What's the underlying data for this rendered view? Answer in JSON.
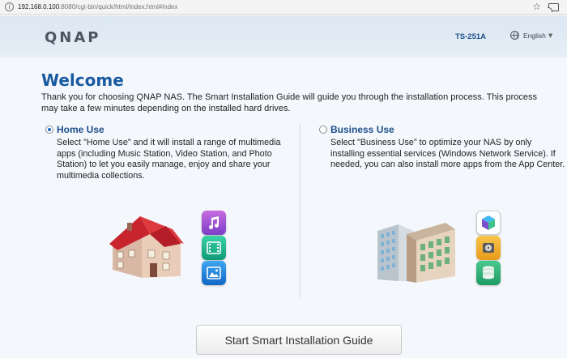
{
  "browser": {
    "url_host": "192.168.0.100",
    "url_rest": ":8080/cgi-bin/quick/html/index.html#index"
  },
  "header": {
    "logo": "QNAP",
    "model": "TS-251A",
    "language": "English"
  },
  "main": {
    "title": "Welcome",
    "intro": "Thank you for choosing QNAP NAS. The Smart Installation Guide will guide you through the installation process. This process may take a few minutes depending on the installed hard drives.",
    "options": [
      {
        "label": "Home Use",
        "selected": true,
        "description": "Select \"Home Use\" and it will install a range of multimedia apps (including Music Station, Video Station, and Photo Station) to let you easily manage, enjoy and share your multimedia collections."
      },
      {
        "label": "Business Use",
        "selected": false,
        "description": "Select \"Business Use\" to optimize your NAS by only installing essential services (Windows Network Service). If needed, you can also install more apps from the App Center."
      }
    ],
    "start_button": "Start Smart Installation Guide"
  },
  "icons": {
    "home_apps": [
      "music-station-icon",
      "video-station-icon",
      "photo-station-icon"
    ],
    "business_apps": [
      "app-center-icon",
      "backup-icon",
      "storage-icon"
    ]
  },
  "colors": {
    "title": "#195aa0",
    "option_title": "#1d4f8b",
    "header_bg": "#dce7f2",
    "panel_bg": "#f4f8fc"
  }
}
